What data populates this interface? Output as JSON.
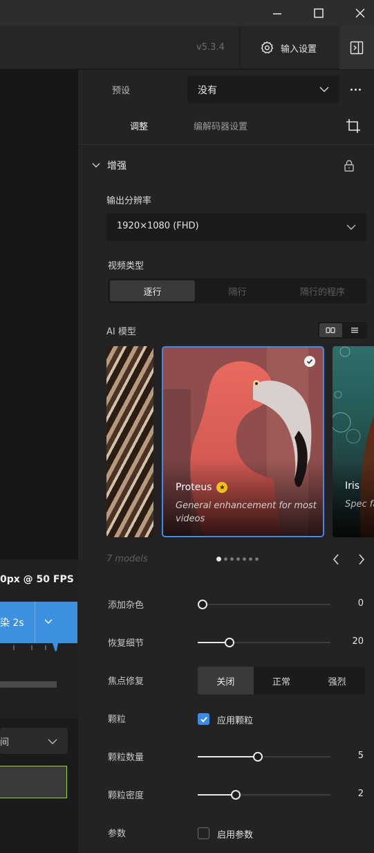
{
  "window": {
    "minimize_icon": "minimize-icon",
    "maximize_icon": "maximize-icon",
    "close_icon": "close-icon"
  },
  "toolbar": {
    "version": "v5.3.4",
    "input_settings_label": "输入设置"
  },
  "left": {
    "fps_text": "0px @ 50 FPS",
    "render_label": "染 2s",
    "select_value": "间"
  },
  "preset": {
    "label": "预设",
    "value": "没有"
  },
  "tabs": {
    "adjust": "调整",
    "codec": "编解码器设置"
  },
  "enhance": {
    "title": "增强",
    "resolution_label": "输出分辨率",
    "resolution_value": "1920×1080 (FHD)",
    "video_type_label": "视频类型",
    "video_types": [
      "逐行",
      "隔行",
      "隔行的程序"
    ],
    "video_type_selected": "逐行",
    "ai_model_label": "AI 模型"
  },
  "models": {
    "count_text": "7 models",
    "pages": 7,
    "current_page": 1,
    "cards": [
      {
        "name": "",
        "description": ""
      },
      {
        "name": "Proteus",
        "description": "General enhancement for most videos",
        "selected": true,
        "featured": true
      },
      {
        "name": "Iris",
        "description": "Spec face"
      }
    ]
  },
  "controls": {
    "add_noise": {
      "label": "添加杂色",
      "value": "0",
      "level": 0.0
    },
    "recover_detail": {
      "label": "恢复细节",
      "value": "20",
      "level": 0.22
    },
    "focus_fix": {
      "label": "焦点修复",
      "options": [
        "关闭",
        "正常",
        "强烈"
      ],
      "selected": "关闭"
    },
    "grain": {
      "label": "颗粒",
      "checkbox_label": "应用颗粒",
      "checked": true
    },
    "grain_amount": {
      "label": "颗粒数量",
      "value": "5",
      "level": 0.45
    },
    "grain_density": {
      "label": "颗粒密度",
      "value": "2",
      "level": 0.27
    },
    "params": {
      "label": "参数",
      "checkbox_label": "启用参数",
      "checked": false
    }
  },
  "colors": {
    "accent": "#3c8ce8",
    "render_button": "#3d8fe0",
    "panel_bg": "#232323",
    "star": "#f0c21f"
  }
}
